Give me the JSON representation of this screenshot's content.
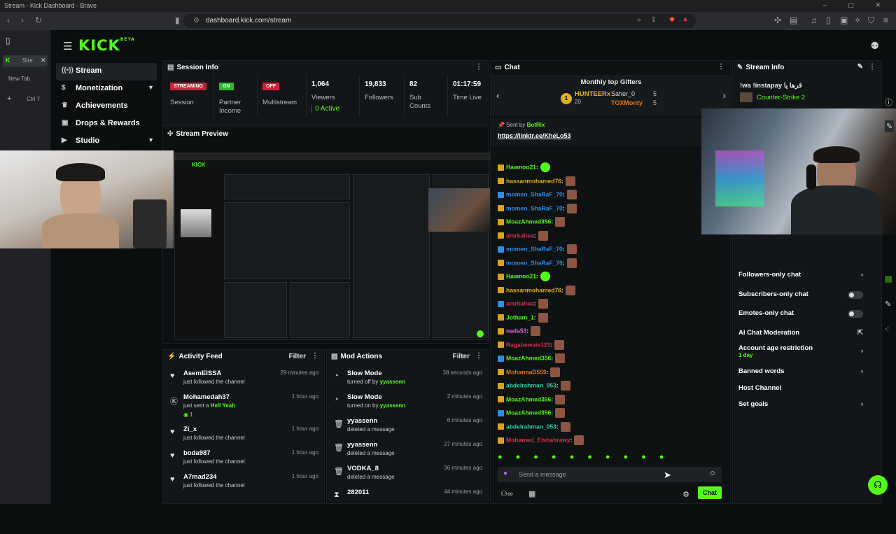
{
  "window": {
    "title": "Stream - Kick Dashboard - Brave"
  },
  "browser": {
    "url": "dashboard.kick.com/stream"
  },
  "tabs": [
    {
      "label": "Stre"
    },
    {
      "label": "New Tab"
    }
  ],
  "tab_shortcut": "Ctrl T",
  "brand": {
    "logo": "KICK",
    "beta": "BETA",
    "accent": "#53fc18"
  },
  "sidebar": {
    "items": [
      {
        "label": "Stream",
        "icon": "radio-icon"
      },
      {
        "label": "Monetization",
        "icon": "dollar-icon"
      },
      {
        "label": "Achievements",
        "icon": "trophy-icon"
      },
      {
        "label": "Drops & Rewards",
        "icon": "gift-icon"
      },
      {
        "label": "Studio",
        "icon": "video-icon"
      }
    ]
  },
  "session": {
    "title": "Session Info",
    "streaming_badge": "STREAMING",
    "session_label": "Session",
    "partner_badge": "ON",
    "partner_label": "Partner Income",
    "multistream_badge": "OFF",
    "multistream_label": "Multistream",
    "viewers": "1,064",
    "viewers_label": "Viewers",
    "active": "0 Active",
    "followers": "19,833",
    "followers_label": "Followers",
    "subs": "82",
    "subs_label": "Sub Counts",
    "time": "01:17:59",
    "time_label": "Time Live"
  },
  "preview": {
    "title": "Stream Preview"
  },
  "activity": {
    "title": "Activity Feed",
    "filter": "Filter",
    "items": [
      {
        "name": "AsemEISSA",
        "sub": "just followed the channel",
        "time": "29 minutes ago"
      },
      {
        "name": "Mohamedah37",
        "sub": "just sent a",
        "gift": "Hell Yeah",
        "count": "1",
        "time": "1 hour ago"
      },
      {
        "name": "Zi_x",
        "sub": "just followed the channel",
        "time": "1 hour ago"
      },
      {
        "name": "boda987",
        "sub": "just followed the channel",
        "time": "1 hour ago"
      },
      {
        "name": "A7mad234",
        "sub": "just followed the channel",
        "time": "1 hour ago"
      }
    ]
  },
  "modactions": {
    "title": "Mod Actions",
    "filter": "Filter",
    "items": [
      {
        "name": "Slow Mode",
        "sub": "turned off by",
        "by": "yyassenn",
        "time": "38 seconds ago"
      },
      {
        "name": "Slow Mode",
        "sub": "turned on by",
        "by": "yyassenn",
        "time": "2 minutes ago"
      },
      {
        "name": "yyassenn",
        "sub": "deleted a message",
        "by": "",
        "time": "6 minutes ago"
      },
      {
        "name": "yyassenn",
        "sub": "deleted a message",
        "by": "",
        "time": "27 minutes ago"
      },
      {
        "name": "VODKA_8",
        "sub": "deleted a message",
        "by": "",
        "time": "36 minutes ago"
      },
      {
        "name": "282011",
        "sub": "",
        "by": "",
        "time": "44 minutes ago"
      }
    ]
  },
  "chat": {
    "title": "Chat",
    "gifters_title": "Monthly top Gifters",
    "gifters": [
      {
        "name": "HUNTEERx",
        "count": "20"
      },
      {
        "name": "Saher_0",
        "count": "5"
      },
      {
        "name": "TOXMonty",
        "count": "5"
      }
    ],
    "pinned_sender_prefix": "Sent by",
    "pinned_sender": "BotRix",
    "pinned_link": "https://linktr.ee/KheLo53",
    "messages": [
      {
        "user": "Haamoo21",
        "color": "#53fc18"
      },
      {
        "user": "hassanmohamed76",
        "color": "#e0b020"
      },
      {
        "user": "momen_ShaRaF_70",
        "color": "#2f8de4"
      },
      {
        "user": "momen_ShaRaF_70",
        "color": "#2f8de4"
      },
      {
        "user": "MoazAhmed356",
        "color": "#53fc18"
      },
      {
        "user": "amrkahea",
        "color": "#d23252"
      },
      {
        "user": "momen_ShaRaF_70",
        "color": "#2f8de4"
      },
      {
        "user": "momen_ShaRaF_70",
        "color": "#2f8de4"
      },
      {
        "user": "Haamoo21",
        "color": "#53fc18"
      },
      {
        "user": "hassanmohamed76",
        "color": "#e0b020"
      },
      {
        "user": "amrkahea",
        "color": "#d23252"
      },
      {
        "user": "Jotham_1",
        "color": "#53fc18"
      },
      {
        "user": "nada53",
        "color": "#e06ad9"
      },
      {
        "user": "Ragabewaie123",
        "color": "#d23252"
      },
      {
        "user": "MoazAhmed356",
        "color": "#53fc18"
      },
      {
        "user": "MohannaD559",
        "color": "#e07820"
      },
      {
        "user": "abdelrahman_053",
        "color": "#2fd2a4"
      },
      {
        "user": "MoazAhmed356",
        "color": "#53fc18"
      },
      {
        "user": "MoazAhmed356",
        "color": "#53fc18"
      },
      {
        "user": "abdelrahman_053",
        "color": "#2fd2a4"
      },
      {
        "user": "Mohamed_Elshahrawy",
        "color": "#d23252"
      }
    ],
    "input_placeholder": "Send a message",
    "send_label": "Chat"
  },
  "streaminfo": {
    "title": "Stream Info",
    "stream_title": "!wa !instapay قرها يا",
    "category": "Counter-Strike 2",
    "settings": [
      {
        "label": "Followers-only chat",
        "type": "arrow"
      },
      {
        "label": "Subscribers-only chat",
        "type": "toggle"
      },
      {
        "label": "Emotes-only chat",
        "type": "toggle"
      },
      {
        "label": "AI Chat Moderation",
        "type": "external"
      },
      {
        "label": "Account age restriction",
        "sub": "1 day",
        "type": "arrow"
      },
      {
        "label": "Banned words",
        "type": "arrow"
      },
      {
        "label": "Host Channel",
        "type": "none"
      },
      {
        "label": "Set goals",
        "type": "arrow"
      }
    ]
  }
}
